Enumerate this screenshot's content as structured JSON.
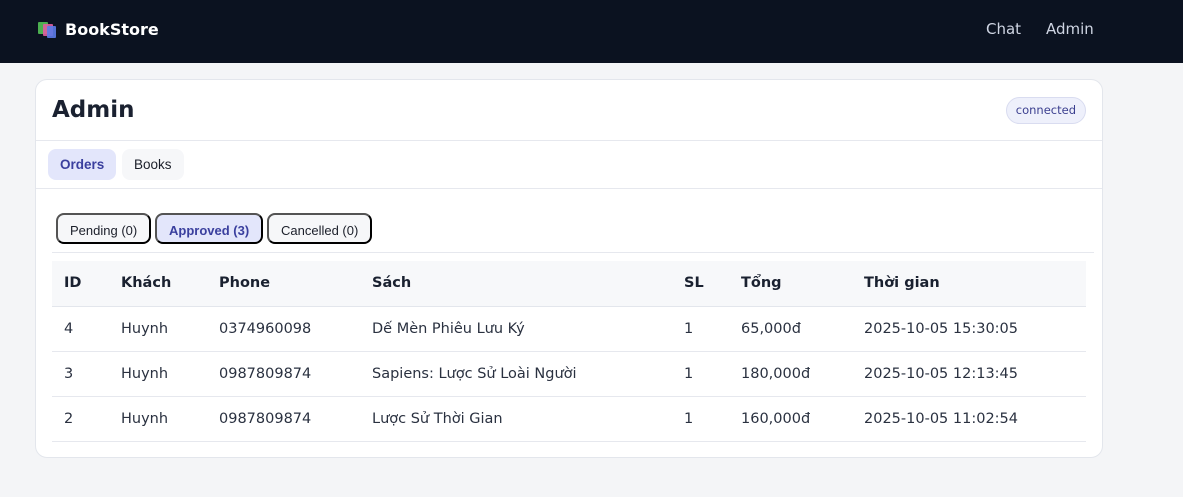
{
  "navbar": {
    "brand": "BookStore",
    "links": [
      "Chat",
      "Admin"
    ]
  },
  "admin": {
    "title": "Admin",
    "status": "connected",
    "tabs": [
      "Orders",
      "Books"
    ],
    "active_tab": "Orders",
    "subtabs": [
      "Pending (0)",
      "Approved (3)",
      "Cancelled (0)"
    ],
    "active_subtab": "Approved (3)"
  },
  "orders_table": {
    "headers": [
      "ID",
      "Khách",
      "Phone",
      "Sách",
      "SL",
      "Tổng",
      "Thời gian"
    ],
    "rows": [
      [
        "4",
        "Huynh",
        "0374960098",
        "Dế Mèn Phiêu Lưu Ký",
        "1",
        "65,000đ",
        "2025-10-05 15:30:05"
      ],
      [
        "3",
        "Huynh",
        "0987809874",
        "Sapiens: Lược Sử Loài Người",
        "1",
        "180,000đ",
        "2025-10-05 12:13:45"
      ],
      [
        "2",
        "Huynh",
        "0987809874",
        "Lược Sử Thời Gian",
        "1",
        "160,000đ",
        "2025-10-05 11:02:54"
      ]
    ]
  },
  "colors": {
    "navbar_bg": "#0b1220",
    "active_tab_bg": "#e3e6fb",
    "active_tab_text": "#3a3f9e"
  },
  "icons": {
    "brand": "books-logo-icon"
  }
}
